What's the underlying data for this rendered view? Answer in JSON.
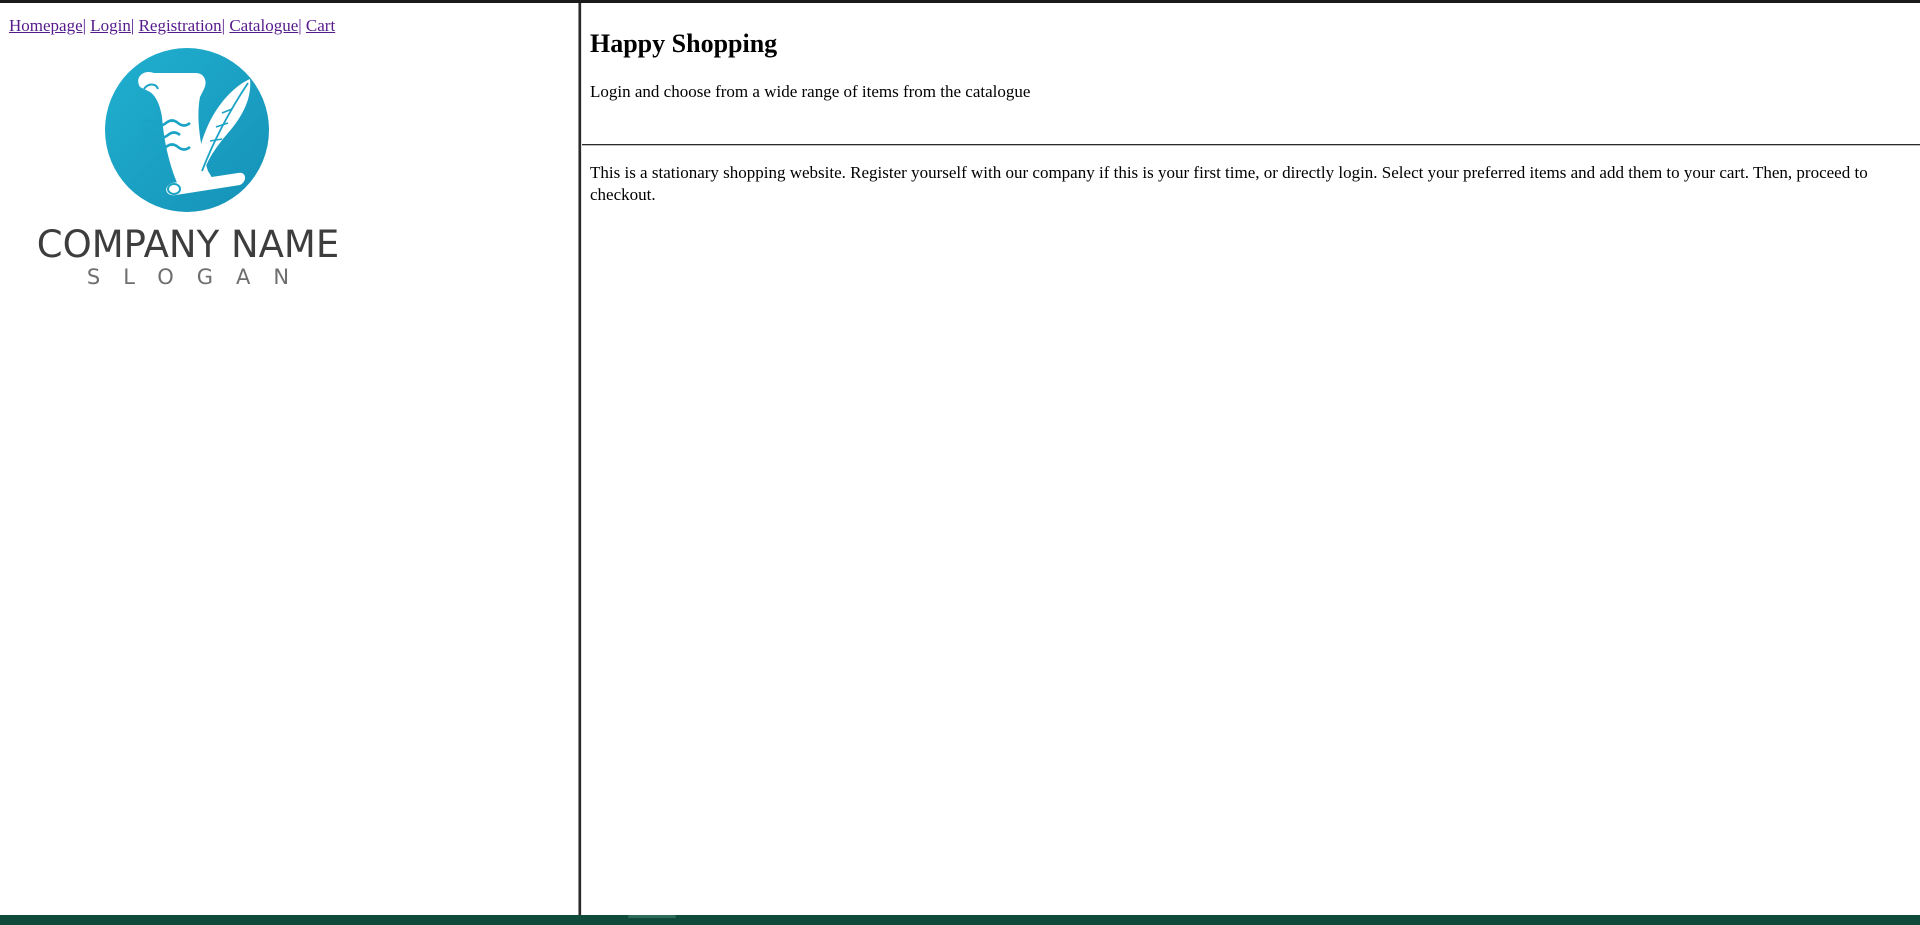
{
  "nav": {
    "links": [
      {
        "label": "Homepage"
      },
      {
        "label": "Login"
      },
      {
        "label": "Registration"
      },
      {
        "label": "Catalogue"
      },
      {
        "label": "Cart"
      }
    ],
    "separator": "|"
  },
  "logo": {
    "company_name": "COMPANY NAME",
    "slogan": "SLOGAN",
    "icon": "scroll-and-quill-icon",
    "circle_color": "#1ba3c6"
  },
  "header": {
    "title": "Happy Shopping",
    "tagline": "Login and choose from a wide range of items from the catalogue"
  },
  "main": {
    "description": "This is a stationary shopping website. Register yourself with our company if this is your first time, or directly login. Select your preferred items and add them to your cart. Then, proceed to checkout."
  },
  "colors": {
    "link_visited": "#551a8b",
    "taskbar": "#0f4a3a"
  }
}
